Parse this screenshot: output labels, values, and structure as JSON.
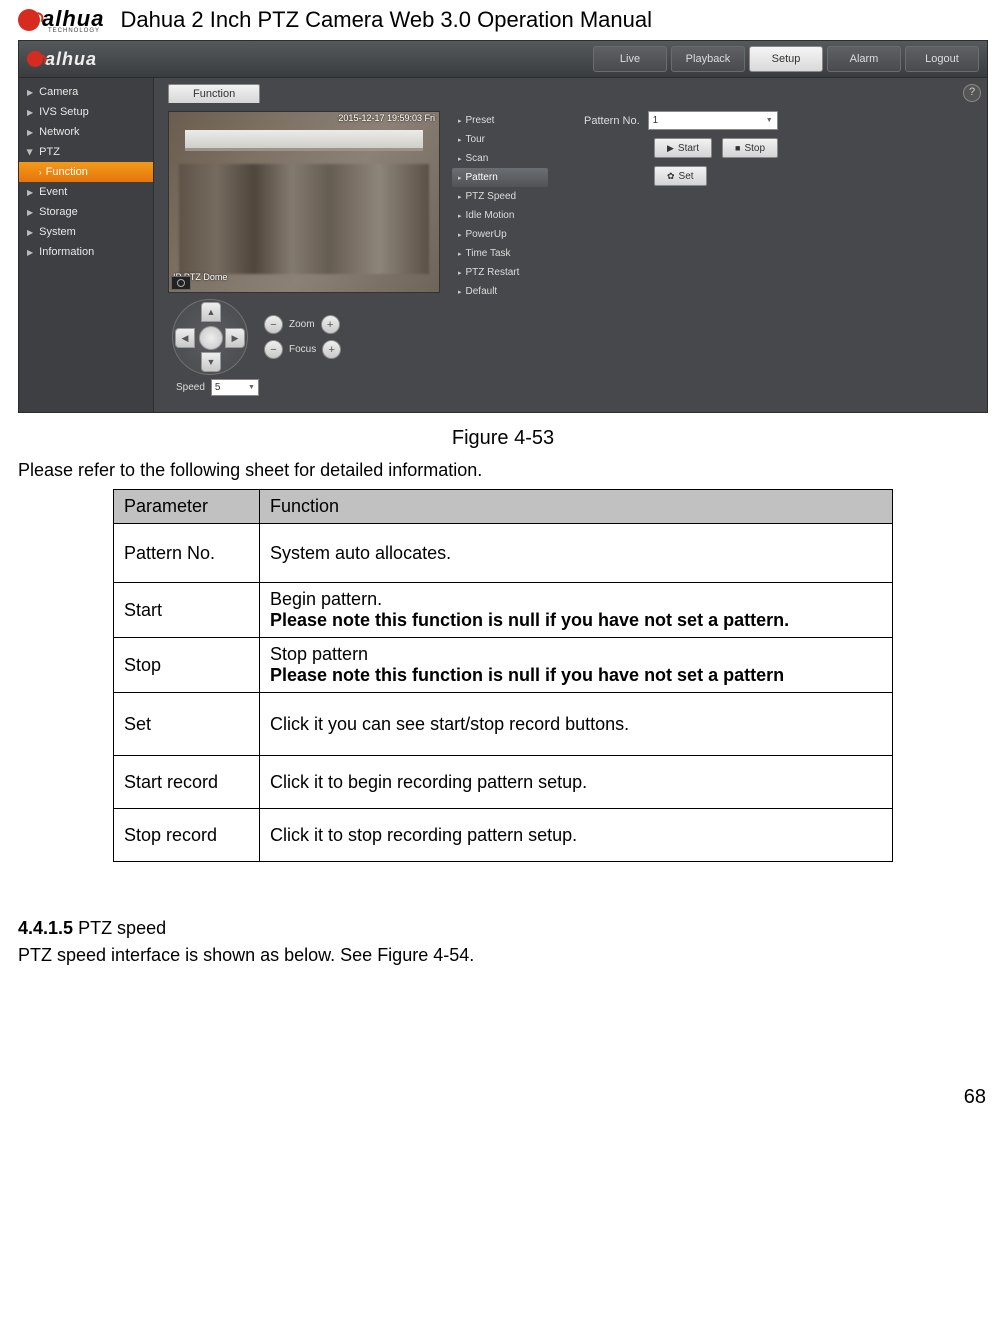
{
  "header": {
    "logo_word": "alhua",
    "logo_sub": "TECHNOLOGY",
    "title": "Dahua 2 Inch PTZ Camera Web 3.0 Operation Manual"
  },
  "app": {
    "logo_word": "alhua",
    "tabs": {
      "live": "Live",
      "playback": "Playback",
      "setup": "Setup",
      "alarm": "Alarm",
      "logout": "Logout"
    },
    "help": "?",
    "sidebar": {
      "camera": "Camera",
      "ivs": "IVS Setup",
      "network": "Network",
      "ptz": "PTZ",
      "function": "Function",
      "event": "Event",
      "storage": "Storage",
      "system": "System",
      "information": "Information"
    },
    "function_tab": "Function",
    "video": {
      "timestamp": "2015-12-17 19:59:03 Fri",
      "label": "IP PTZ Dome"
    },
    "ptz_sub": {
      "preset": "Preset",
      "tour": "Tour",
      "scan": "Scan",
      "pattern": "Pattern",
      "ptzspeed": "PTZ Speed",
      "idle": "Idle Motion",
      "powerup": "PowerUp",
      "timetask": "Time Task",
      "ptzrestart": "PTZ Restart",
      "default": "Default"
    },
    "pattern": {
      "label": "Pattern No.",
      "value": "1",
      "start": "Start",
      "stop": "Stop",
      "set": "Set"
    },
    "zoom_label": "Zoom",
    "focus_label": "Focus",
    "speed_label": "Speed",
    "speed_value": "5"
  },
  "figure_caption": "Figure 4-53",
  "intro_text": "Please refer to the following sheet for detailed information.",
  "table": {
    "head": {
      "c1": "Parameter",
      "c2": "Function"
    },
    "rows": [
      {
        "p": "Pattern No.",
        "f": "System auto allocates."
      },
      {
        "p": "Start",
        "f1": "Begin pattern.",
        "f2": "Please note this function is null if you have not set a pattern."
      },
      {
        "p": "Stop",
        "f1": "Stop pattern",
        "f2": "Please note this function is null if you have not set a pattern"
      },
      {
        "p": "Set",
        "f": "Click it you can see start/stop record buttons."
      },
      {
        "p": "Start record",
        "f": "Click it to begin recording pattern setup."
      },
      {
        "p": "Stop record",
        "f": "Click it to stop recording pattern setup."
      }
    ]
  },
  "section": {
    "num": "4.4.1.5",
    "title": "PTZ speed",
    "body": "PTZ speed interface is shown as below. See Figure 4-54."
  },
  "page_number": "68"
}
